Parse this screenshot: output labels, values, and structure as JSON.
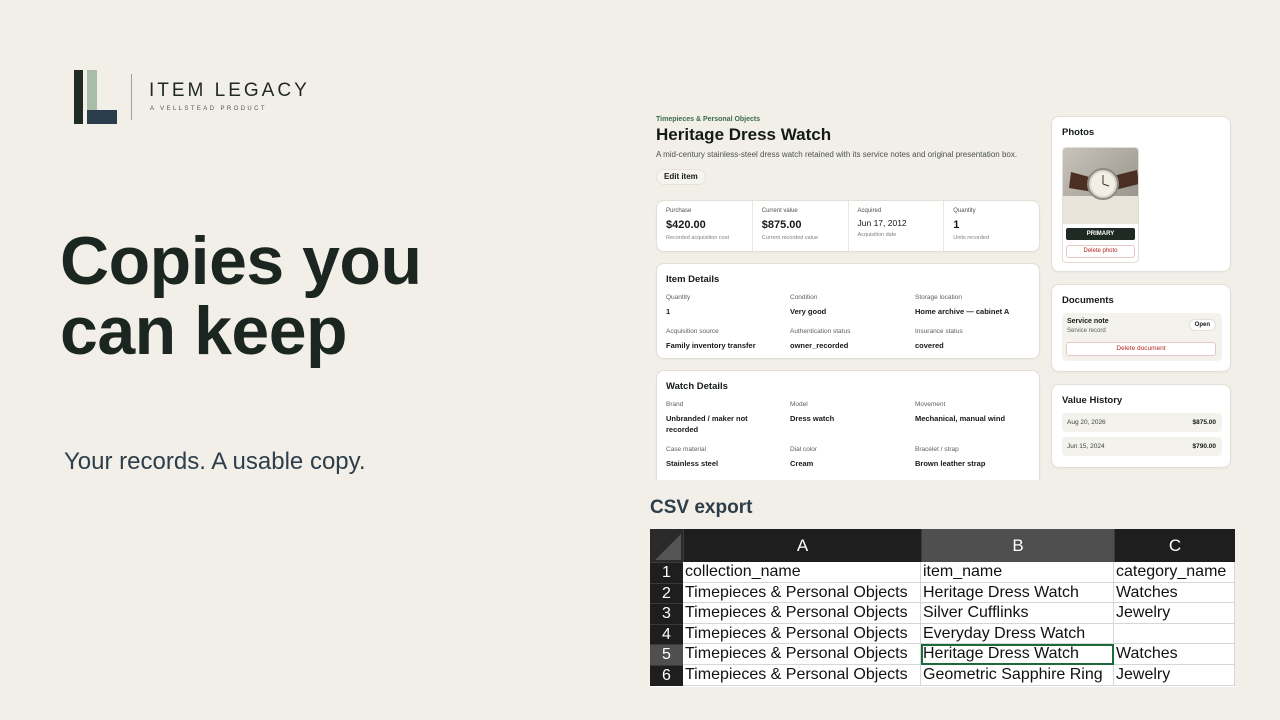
{
  "brand": {
    "name": "ITEM LEGACY",
    "tagline": "A VELLSTEAD PRODUCT"
  },
  "hero": {
    "headline_line1": "Copies you",
    "headline_line2": "can keep",
    "subline": "Your records. A usable copy."
  },
  "item": {
    "breadcrumb": "Timepieces & Personal Objects",
    "title": "Heritage Dress Watch",
    "description": "A mid-century stainless-steel dress watch retained with its service notes and original presentation box.",
    "edit_label": "Edit item"
  },
  "stats": [
    {
      "label": "Purchase",
      "value": "$420.00",
      "sub": "Recorded acquisition cost"
    },
    {
      "label": "Current value",
      "value": "$875.00",
      "sub": "Current recorded value"
    },
    {
      "label": "Acquired",
      "value": "Jun 17, 2012",
      "sub": "Acquisition date"
    },
    {
      "label": "Quantity",
      "value": "1",
      "sub": "Units recorded"
    }
  ],
  "item_details": {
    "title": "Item Details",
    "fields": [
      {
        "label": "Quantity",
        "value": "1"
      },
      {
        "label": "Condition",
        "value": "Very good"
      },
      {
        "label": "Storage location",
        "value": "Home archive — cabinet A"
      },
      {
        "label": "Acquisition source",
        "value": "Family inventory transfer"
      },
      {
        "label": "Authentication status",
        "value": "owner_recorded"
      },
      {
        "label": "Insurance status",
        "value": "covered"
      }
    ]
  },
  "watch_details": {
    "title": "Watch Details",
    "fields": [
      {
        "label": "Brand",
        "value": "Unbranded / maker not recorded"
      },
      {
        "label": "Model",
        "value": "Dress watch"
      },
      {
        "label": "Movement",
        "value": "Mechanical, manual wind"
      },
      {
        "label": "Case material",
        "value": "Stainless steel"
      },
      {
        "label": "Dial color",
        "value": "Cream"
      },
      {
        "label": "Bracelet / strap",
        "value": "Brown leather strap"
      }
    ]
  },
  "photos": {
    "title": "Photos",
    "primary_label": "PRIMARY",
    "delete_label": "Delete photo"
  },
  "documents": {
    "title": "Documents",
    "name": "Service note",
    "type": "Service record",
    "open_label": "Open",
    "delete_label": "Delete document"
  },
  "value_history": {
    "title": "Value History",
    "rows": [
      {
        "date": "Aug 20, 2026",
        "value": "$875.00"
      },
      {
        "date": "Jun 15, 2024",
        "value": "$790.00"
      }
    ]
  },
  "csv": {
    "label": "CSV export",
    "columns": [
      "A",
      "B",
      "C"
    ],
    "rows": [
      {
        "num": "1",
        "cells": [
          "collection_name",
          "item_name",
          "category_name"
        ]
      },
      {
        "num": "2",
        "cells": [
          "Timepieces & Personal Objects",
          "Heritage Dress Watch",
          "Watches"
        ]
      },
      {
        "num": "3",
        "cells": [
          "Timepieces & Personal Objects",
          "Silver Cufflinks",
          "Jewelry"
        ]
      },
      {
        "num": "4",
        "cells": [
          "Timepieces & Personal Objects",
          "Everyday Dress Watch",
          ""
        ]
      },
      {
        "num": "5",
        "cells": [
          "Timepieces & Personal Objects",
          "Heritage Dress Watch",
          "Watches"
        ]
      },
      {
        "num": "6",
        "cells": [
          "Timepieces & Personal Objects",
          "Geometric Sapphire Ring",
          "Jewelry"
        ]
      }
    ]
  },
  "colors": {
    "background": "#f2efe8",
    "ink": "#1c2620",
    "accent_green": "#3d6a4d",
    "danger": "#b3261e"
  }
}
